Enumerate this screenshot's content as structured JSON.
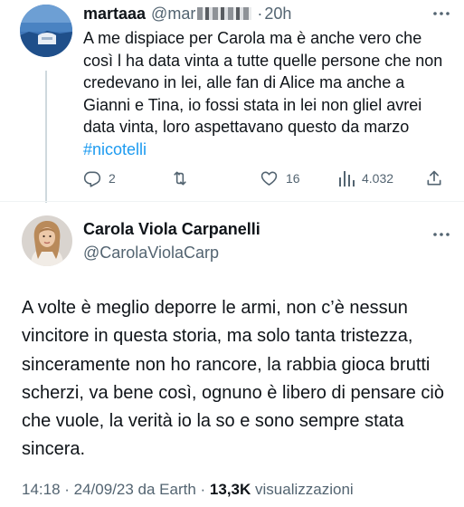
{
  "reply_tweet": {
    "display_name": "martaaa",
    "handle": "@mar",
    "separator": "·",
    "time": "20h",
    "text": "A me dispiace per Carola ma è anche vero che così l ha data vinta a tutte quelle persone che non credevano in lei, alle fan di Alice ma anche a Gianni e Tina, io fossi stata in lei non gliel avrei data vinta, loro aspettavano questo da marzo ",
    "hashtag": "#nicotelli",
    "reply_count": "2",
    "like_count": "16",
    "view_count": "4.032"
  },
  "main_tweet": {
    "display_name": "Carola Viola Carpanelli",
    "handle": "@CarolaViolaCarp",
    "text": "A volte è meglio deporre le armi, non c’è nessun vincitore in questa storia, ma solo tanta tristezza, sinceramente non ho rancore, la rabbia gioca brutti scherzi, va bene così, ognuno è libero di pensare ciò che vuole, la verità io la so e sono sempre stata sincera.",
    "timestamp": "14:18 · 24/09/23 da Earth · ",
    "views_count": "13,3K",
    "views_label": " visualizzazioni"
  },
  "icons": [
    "more-icon",
    "reply-icon",
    "retweet-icon",
    "like-icon",
    "views-icon",
    "share-icon"
  ],
  "colors": {
    "text_primary": "#0f1419",
    "text_secondary": "#536471",
    "link": "#1d9bf0",
    "divider": "#eff3f4",
    "thread_line": "#cfd9de"
  }
}
